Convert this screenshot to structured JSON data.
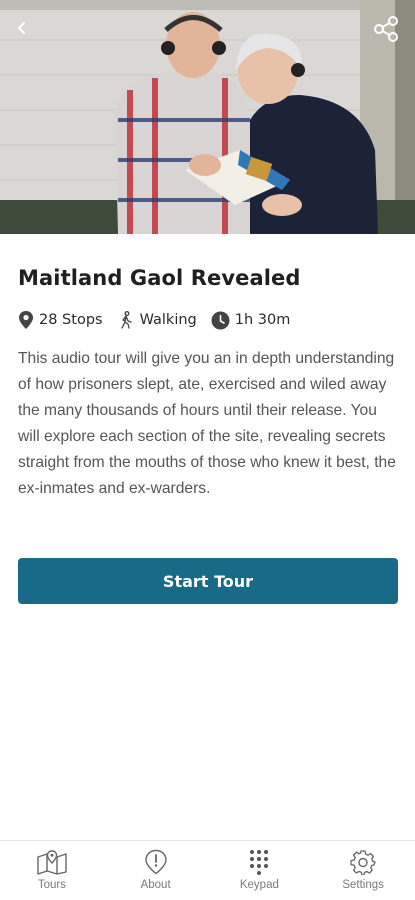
{
  "header": {
    "back_icon": "chevron-left-icon",
    "share_icon": "share-icon"
  },
  "tour": {
    "title": "Maitland Gaol Revealed",
    "stops": "28 Stops",
    "mode": "Walking",
    "duration": "1h 30m",
    "description": "This audio tour will give you an in depth understanding of how prisoners slept, ate, exercised and wiled away the many thousands of hours until their release. You will explore each section of the site, revealing secrets straight from the mouths of those who knew it best, the ex-inmates and ex-warders.",
    "start_label": "Start Tour"
  },
  "nav": {
    "tours": "Tours",
    "about": "About",
    "keypad": "Keypad",
    "settings": "Settings"
  },
  "colors": {
    "primary": "#176b86",
    "text": "#1f1f1f",
    "muted": "#7a7a7a"
  }
}
